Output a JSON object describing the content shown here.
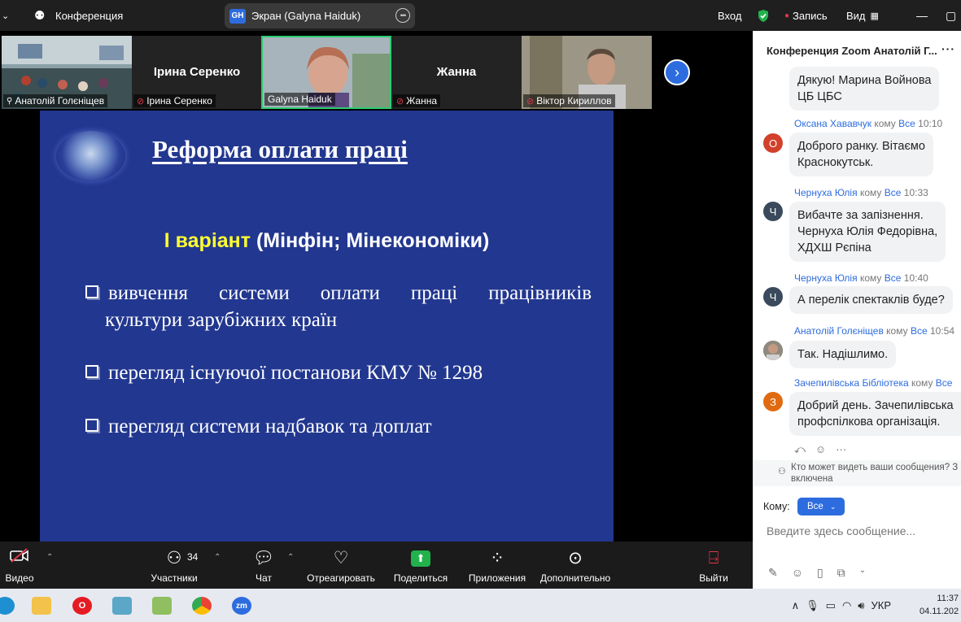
{
  "topbar": {
    "title": "Конференция",
    "share_label": "Экран (Galyna Haiduk)",
    "share_badge": "GH",
    "signin": "Вход",
    "record": "Запись",
    "view": "Вид"
  },
  "gallery": {
    "tiles": [
      {
        "label": "Анатолій Голєніщев"
      },
      {
        "name": "Ірина Серенко",
        "label": "Ірина Серенко"
      },
      {
        "label": "Galyna Haiduk"
      },
      {
        "name": "Жанна",
        "label": "Жанна"
      },
      {
        "label": "Віктор Кириллов"
      }
    ]
  },
  "slide": {
    "title": "Реформа оплати праці",
    "subtitle_highlight": "І варіант",
    "subtitle_rest": " (Мінфін; Мінекономіки)",
    "bullets": [
      {
        "line1": "вивчення системи оплати праці працівників",
        "line2": "культури зарубіжних країн"
      },
      {
        "line1": "перегляд існуючої постанови КМУ № 1298"
      },
      {
        "line1": "перегляд  системи надбавок та доплат"
      }
    ]
  },
  "chat": {
    "header": "Конференция Zoom Анатолій Г...",
    "messages": [
      {
        "text1": "Дякую!  Марина Войнова",
        "text2": "ЦБ ЦБС"
      },
      {
        "sender": "Оксана Хававчук",
        "to": "кому",
        "target": "Все",
        "time": "10:10",
        "avatar": "О",
        "avatar_color": "#d2412b",
        "text1": "Доброго ранку. Вітаємо",
        "text2": "Краснокутськ."
      },
      {
        "sender": "Чернуха Юлія",
        "to": "кому",
        "target": "Все",
        "time": "10:33",
        "avatar": "Ч",
        "avatar_color": "#3a4a5c",
        "text1": "Вибачте за запізнення.",
        "text2": "Чернуха Юлія Федорівна,",
        "text3": "ХДХШ Рєпіна"
      },
      {
        "sender": "Чернуха Юлія",
        "to": "кому",
        "target": "Все",
        "time": "10:40",
        "avatar": "Ч",
        "avatar_color": "#3a4a5c",
        "text1": "А перелік спектаклів буде?"
      },
      {
        "sender": "Анатолій Голєніщев",
        "to": "кому",
        "target": "Все",
        "time": "10:54",
        "text1": "Так. Надішлимо."
      },
      {
        "sender": "Зачепилівська Бібліотека",
        "to": "кому",
        "target": "Все",
        "avatar": "З",
        "avatar_color": "#e06a10",
        "text1": "Добрий день. Зачепилівська",
        "text2": "профспілкова організація."
      }
    ],
    "info_line1": "Кто может видеть ваши сообщения? З",
    "info_line2": "включена",
    "to_label": "Кому:",
    "to_value": "Все",
    "input_placeholder": "Введите здесь сообщение..."
  },
  "toolbar": {
    "video": "Видео",
    "participants": "Участники",
    "participants_count": "34",
    "chat": "Чат",
    "react": "Отреагировать",
    "share": "Поделиться",
    "apps": "Приложения",
    "more": "Дополнительно",
    "leave": "Выйти"
  },
  "taskbar": {
    "lang": "УКР",
    "time": "11:37",
    "date": "04.11.202"
  }
}
